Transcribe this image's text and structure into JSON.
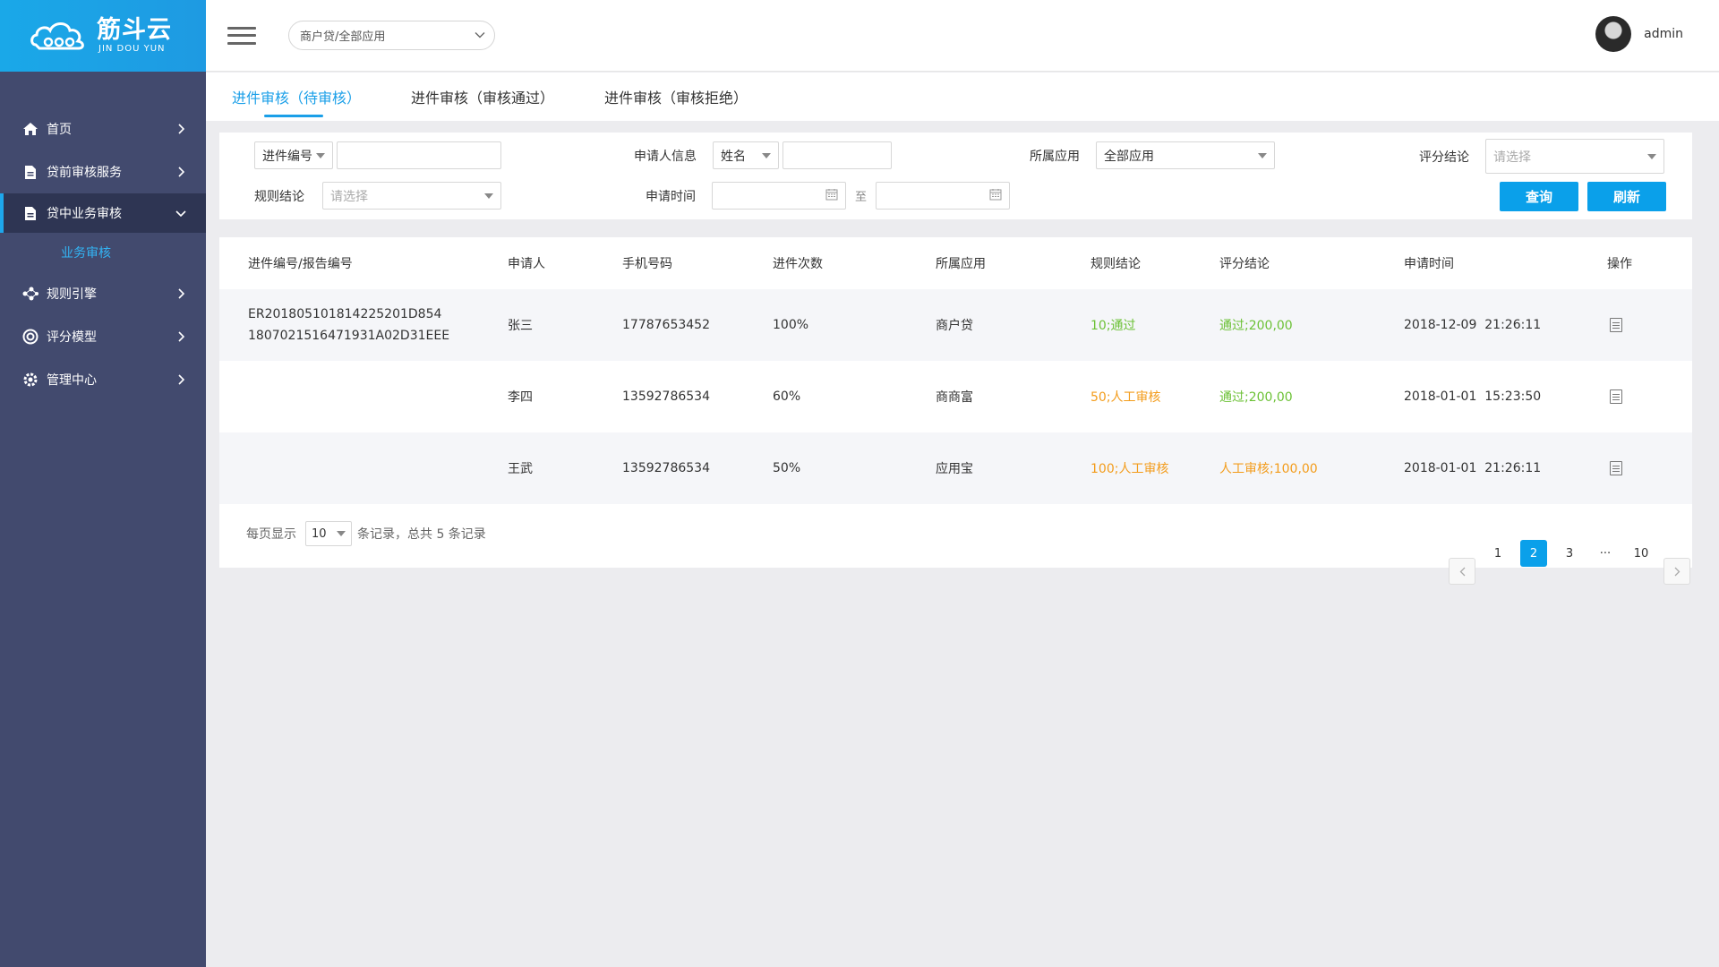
{
  "brand": {
    "name": "筋斗云",
    "sub": "JIN DOU YUN"
  },
  "sidebar": {
    "items": [
      {
        "label": "首页",
        "icon": "home-icon"
      },
      {
        "label": "贷前审核服务",
        "icon": "document-icon"
      },
      {
        "label": "贷中业务审核",
        "icon": "document-icon",
        "active": true
      },
      {
        "label": "规则引擎",
        "icon": "nodes-icon"
      },
      {
        "label": "评分模型",
        "icon": "target-icon"
      },
      {
        "label": "管理中心",
        "icon": "gear-icon"
      }
    ],
    "sub": {
      "label": "业务审核"
    }
  },
  "header": {
    "app_select": "商户贷/全部应用",
    "user": "admin"
  },
  "tabs": [
    {
      "label": "进件审核（待审核）",
      "active": true
    },
    {
      "label": "进件审核（审核通过）"
    },
    {
      "label": "进件审核（审核拒绝）"
    }
  ],
  "filter": {
    "no_select": "进件编号",
    "applicant_label": "申请人信息",
    "applicant_select": "姓名",
    "app_label": "所属应用",
    "app_value": "全部应用",
    "score_label": "评分结论",
    "score_placeholder": "请选择",
    "rule_label": "规则结论",
    "rule_placeholder": "请选择",
    "time_label": "申请时间",
    "to": "至",
    "query": "查询",
    "refresh": "刷新"
  },
  "table": {
    "headers": [
      "进件编号/报告编号",
      "申请人",
      "手机号码",
      "进件次数",
      "所属应用",
      "规则结论",
      "评分结论",
      "申请时间",
      "操作"
    ],
    "rows": [
      {
        "no": "ER20180510181422520​1D854",
        "report": "1807021516471931A02D31EEE",
        "name": "张三",
        "phone": "17787653452",
        "count": "100%",
        "app": "商户贷",
        "rule": "10;通过",
        "score": "通过;200,00",
        "time": "2018-12-09  21:26:11",
        "rule_color": "green",
        "score_color": "green"
      },
      {
        "no": "",
        "report": "",
        "name": "李四",
        "phone": "13592786534",
        "count": "60%",
        "app": "商商富",
        "rule": "50;人工审核",
        "score": "通过;200,00",
        "time": "2018-01-01  15:23:50",
        "rule_color": "orange",
        "score_color": "green"
      },
      {
        "no": "",
        "report": "",
        "name": "王武",
        "phone": "13592786534",
        "count": "50%",
        "app": "应用宝",
        "rule": "100;人工审核",
        "score": "人工审核;100,00",
        "time": "2018-01-01  21:26:11",
        "rule_color": "orange",
        "score_color": "orange"
      }
    ]
  },
  "pagination": {
    "per_page_label": "每页显示",
    "per_page": "10",
    "summary": "条记录，总共 5 条记录",
    "pages": [
      "1",
      "2",
      "3",
      "···",
      "10"
    ],
    "current": "2"
  },
  "colors": {
    "accent": "#0aa0ea",
    "sidebar": "#424a6e",
    "pass": "#6cc136",
    "manual": "#f39c1b"
  }
}
